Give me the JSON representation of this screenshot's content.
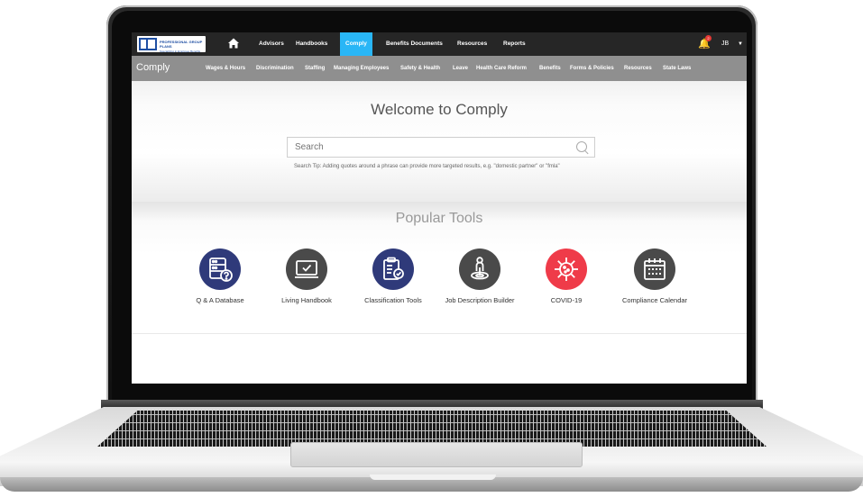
{
  "topbar": {
    "logo_text": "PROFESSIONAL GROUP PLANS",
    "logo_subtext": "Specializing in Employee Benefits",
    "nav": [
      {
        "label": "Advisors"
      },
      {
        "label": "Handbooks"
      },
      {
        "label": "Comply"
      },
      {
        "label": "Benefits Documents"
      },
      {
        "label": "Resources"
      },
      {
        "label": "Reports"
      }
    ],
    "notification_count": "2",
    "user_initials": "JB"
  },
  "subbar": {
    "title": "Comply",
    "items": [
      {
        "label": "Wages & Hours"
      },
      {
        "label": "Discrimination"
      },
      {
        "label": "Staffing"
      },
      {
        "label": "Managing Employees"
      },
      {
        "label": "Safety & Health"
      },
      {
        "label": "Leave"
      },
      {
        "label": "Health Care Reform"
      },
      {
        "label": "Benefits"
      },
      {
        "label": "Forms & Policies"
      },
      {
        "label": "Resources"
      },
      {
        "label": "State Laws"
      }
    ]
  },
  "main": {
    "welcome": "Welcome to Comply",
    "search_placeholder": "Search",
    "search_tip": "Search Tip: Adding quotes around a phrase can provide more targeted results, e.g. \"domestic partner\" or \"fmla\"",
    "tools_title": "Popular Tools",
    "tools": [
      {
        "label": "Q & A Database",
        "color": "#2f3a7a",
        "icon": "database-question-icon"
      },
      {
        "label": "Living Handbook",
        "color": "#4a4a4a",
        "icon": "laptop-check-icon"
      },
      {
        "label": "Classification Tools",
        "color": "#2f3a7a",
        "icon": "clipboard-check-icon"
      },
      {
        "label": "Job Description Builder",
        "color": "#4a4a4a",
        "icon": "person-pin-icon"
      },
      {
        "label": "COVID-19",
        "color": "#ef3b49",
        "icon": "virus-icon"
      },
      {
        "label": "Compliance Calendar",
        "color": "#4a4a4a",
        "icon": "calendar-icon"
      }
    ]
  },
  "colors": {
    "topbar_bg": "#262626",
    "subbar_bg": "#8f8f8f",
    "active_tab": "#29b6f6"
  }
}
